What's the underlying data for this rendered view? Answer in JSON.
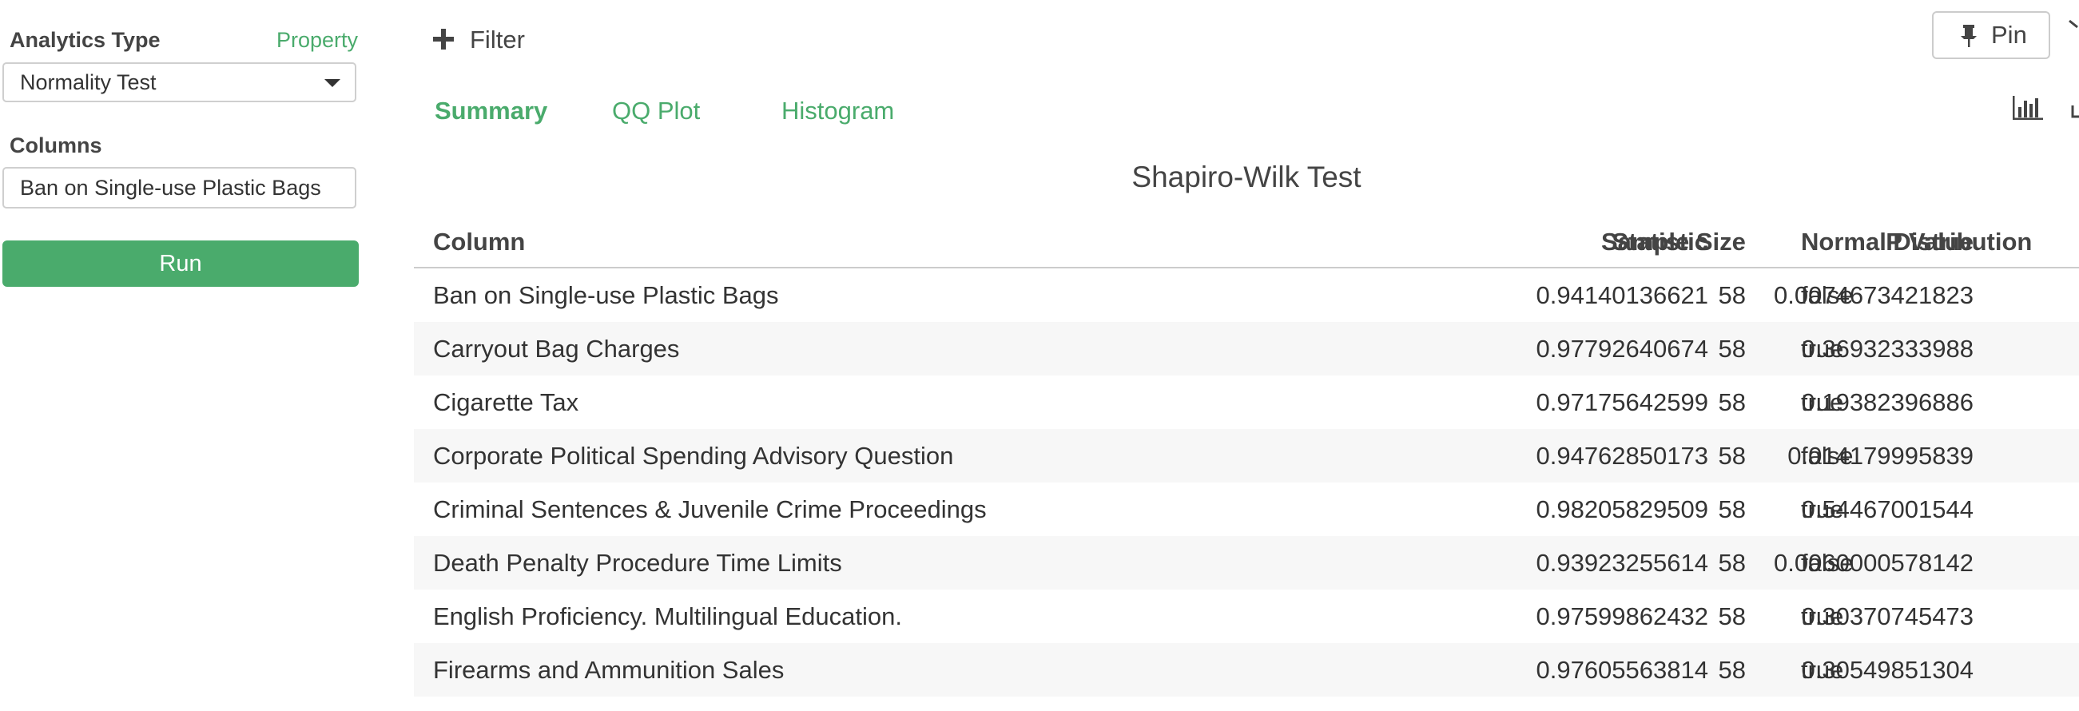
{
  "sidebar": {
    "analytics_type_label": "Analytics Type",
    "property_link": "Property",
    "analytics_type_value": "Normality Test",
    "columns_label": "Columns",
    "columns_value": "Ban on Single-use Plastic Bags",
    "run_label": "Run"
  },
  "toolbar": {
    "filter_label": "Filter",
    "pin_label": "Pin"
  },
  "tabs": [
    {
      "label": "Summary",
      "active": true
    },
    {
      "label": "QQ Plot",
      "active": false
    },
    {
      "label": "Histogram",
      "active": false
    }
  ],
  "table": {
    "title": "Shapiro-Wilk Test",
    "headers": {
      "column": "Column",
      "statistic": "Statistic",
      "p_value": "P Value",
      "sample_size": "Sample Size",
      "normal": "Normal Distribution"
    },
    "rows": [
      {
        "column": "Ban on Single-use Plastic Bags",
        "statistic": "0.94140136621",
        "p_value": "0.0074673421823",
        "sample_size": "58",
        "normal": "false"
      },
      {
        "column": "Carryout Bag Charges",
        "statistic": "0.97792640674",
        "p_value": "0.36932333988",
        "sample_size": "58",
        "normal": "true"
      },
      {
        "column": "Cigarette Tax",
        "statistic": "0.97175642599",
        "p_value": "0.19382396886",
        "sample_size": "58",
        "normal": "true"
      },
      {
        "column": "Corporate Political Spending Advisory Question",
        "statistic": "0.94762850173",
        "p_value": "0.014179995839",
        "sample_size": "58",
        "normal": "false"
      },
      {
        "column": "Criminal Sentences & Juvenile Crime Proceedings",
        "statistic": "0.98205829509",
        "p_value": "0.54467001544",
        "sample_size": "58",
        "normal": "true"
      },
      {
        "column": "Death Penalty Procedure Time Limits",
        "statistic": "0.93923255614",
        "p_value": "0.0060000578142",
        "sample_size": "58",
        "normal": "false"
      },
      {
        "column": "English Proficiency. Multilingual Education.",
        "statistic": "0.97599862432",
        "p_value": "0.30370745473",
        "sample_size": "58",
        "normal": "true"
      },
      {
        "column": "Firearms and Ammunition Sales",
        "statistic": "0.97605563814",
        "p_value": "0.30549851304",
        "sample_size": "58",
        "normal": "true"
      }
    ]
  },
  "icons": {
    "filter": "plus-icon",
    "pin": "pin-icon",
    "chart": "bar-chart-icon",
    "dropdown": "caret-down-icon"
  },
  "colors": {
    "accent": "#4aab6c",
    "row_alt": "#f7f7f7",
    "text": "#333333"
  }
}
